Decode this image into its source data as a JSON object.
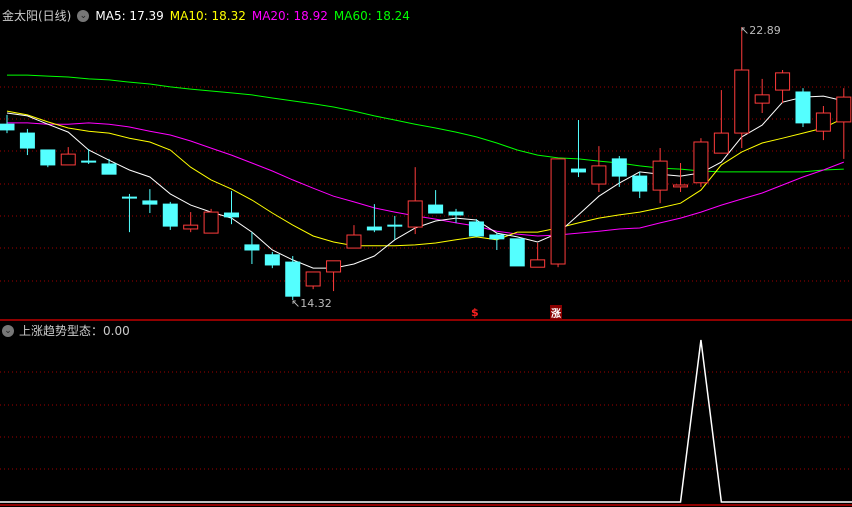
{
  "header": {
    "title": "金太阳(日线)",
    "ma5": "MA5: 17.39",
    "ma10": "MA10: 18.32",
    "ma20": "MA20: 18.92",
    "ma60": "MA60: 18.24"
  },
  "indicator": {
    "title": "上涨趋势型态",
    "value": "：0.00"
  },
  "annotations": {
    "high_label": "22.89",
    "low_label": "14.32",
    "signal_dollar": "$",
    "signal_rise": "涨"
  },
  "colors": {
    "up": "#ff3c3c",
    "down": "#54ffff",
    "ma5": "#ffffff",
    "ma10": "#ffff00",
    "ma20": "#ff00ff",
    "ma60": "#00ff00",
    "grid": "#a00000"
  },
  "chart_data": {
    "type": "candlestick",
    "price_range": [
      14.32,
      22.89
    ],
    "candles": [
      [
        19.84,
        20.13,
        19.56,
        19.66
      ],
      [
        19.56,
        19.69,
        18.87,
        19.09
      ],
      [
        19.03,
        19.03,
        18.49,
        18.56
      ],
      [
        18.56,
        19.12,
        18.56,
        18.9
      ],
      [
        18.68,
        19.06,
        18.59,
        18.66
      ],
      [
        18.59,
        18.75,
        18.27,
        18.27
      ],
      [
        17.55,
        17.65,
        16.45,
        17.53
      ],
      [
        17.43,
        17.8,
        17.05,
        17.33
      ],
      [
        17.33,
        17.4,
        16.52,
        16.64
      ],
      [
        16.55,
        17.08,
        16.45,
        16.67
      ],
      [
        16.42,
        17.18,
        16.42,
        17.08
      ],
      [
        17.05,
        17.74,
        16.7,
        16.93
      ],
      [
        16.05,
        16.45,
        15.45,
        15.89
      ],
      [
        15.74,
        15.83,
        15.32,
        15.42
      ],
      [
        15.51,
        15.7,
        14.32,
        14.44
      ],
      [
        14.76,
        15.2,
        14.66,
        15.2
      ],
      [
        15.2,
        15.55,
        14.6,
        15.55
      ],
      [
        15.95,
        16.67,
        15.95,
        16.36
      ],
      [
        16.61,
        17.33,
        16.45,
        16.52
      ],
      [
        16.67,
        16.96,
        16.21,
        16.66
      ],
      [
        16.61,
        18.49,
        16.39,
        17.43
      ],
      [
        17.3,
        17.77,
        17.05,
        17.05
      ],
      [
        17.08,
        17.18,
        16.74,
        16.99
      ],
      [
        16.77,
        16.86,
        16.3,
        16.33
      ],
      [
        16.36,
        16.42,
        15.89,
        16.24
      ],
      [
        16.24,
        16.24,
        15.39,
        15.39
      ],
      [
        15.35,
        16.11,
        15.35,
        15.58
      ],
      [
        15.45,
        18.75,
        15.35,
        18.75
      ],
      [
        18.43,
        19.97,
        18.18,
        18.34
      ],
      [
        17.96,
        19.15,
        17.71,
        18.53
      ],
      [
        18.75,
        18.84,
        17.87,
        18.21
      ],
      [
        18.21,
        18.34,
        17.52,
        17.74
      ],
      [
        17.77,
        19.09,
        17.36,
        18.68
      ],
      [
        17.87,
        18.62,
        17.71,
        17.93
      ],
      [
        18.0,
        19.4,
        17.87,
        19.28
      ],
      [
        18.93,
        20.91,
        18.93,
        19.56
      ],
      [
        19.56,
        22.89,
        19.09,
        21.54
      ],
      [
        20.5,
        21.26,
        20.19,
        20.76
      ],
      [
        20.91,
        21.54,
        20.5,
        21.45
      ],
      [
        20.85,
        20.97,
        19.75,
        19.88
      ],
      [
        19.62,
        20.41,
        19.34,
        20.19
      ],
      [
        19.91,
        20.97,
        18.75,
        20.69
      ]
    ],
    "ma5": [
      20.19,
      20.1,
      19.84,
      19.59,
      19.03,
      18.71,
      18.4,
      18.18,
      17.65,
      17.3,
      17.08,
      16.89,
      16.45,
      15.89,
      15.58,
      15.32,
      15.32,
      15.45,
      15.7,
      16.21,
      16.58,
      16.8,
      16.89,
      16.83,
      16.42,
      16.3,
      16.14,
      16.42,
      16.99,
      17.58,
      17.99,
      18.34,
      18.27,
      18.21,
      18.31,
      18.65,
      19.44,
      19.81,
      20.53,
      20.69,
      20.72,
      20.57
    ],
    "ma10": [
      20.25,
      20.13,
      19.91,
      19.72,
      19.62,
      19.56,
      19.4,
      19.28,
      19.03,
      18.49,
      18.09,
      17.8,
      17.46,
      17.05,
      16.67,
      16.33,
      16.14,
      16.02,
      16.02,
      16.02,
      16.05,
      16.11,
      16.21,
      16.3,
      16.21,
      16.45,
      16.45,
      16.58,
      16.74,
      16.89,
      16.99,
      17.08,
      17.21,
      17.36,
      17.77,
      18.56,
      18.97,
      19.25,
      19.4,
      19.56,
      19.72,
      20.03
    ],
    "ma20": [
      19.88,
      19.88,
      19.84,
      19.84,
      19.88,
      19.84,
      19.75,
      19.62,
      19.5,
      19.31,
      19.09,
      18.87,
      18.62,
      18.37,
      18.09,
      17.83,
      17.58,
      17.4,
      17.21,
      17.08,
      16.96,
      16.86,
      16.74,
      16.64,
      16.48,
      16.39,
      16.33,
      16.36,
      16.42,
      16.48,
      16.55,
      16.58,
      16.74,
      16.89,
      17.08,
      17.3,
      17.49,
      17.68,
      17.93,
      18.18,
      18.4,
      18.65
    ],
    "ma60": [
      21.38,
      21.38,
      21.35,
      21.32,
      21.26,
      21.23,
      21.16,
      21.1,
      21.01,
      20.94,
      20.88,
      20.82,
      20.76,
      20.66,
      20.57,
      20.48,
      20.38,
      20.25,
      20.1,
      19.97,
      19.84,
      19.72,
      19.59,
      19.44,
      19.25,
      19.03,
      18.87,
      18.78,
      18.75,
      18.68,
      18.62,
      18.53,
      18.46,
      18.43,
      18.37,
      18.34,
      18.34,
      18.34,
      18.34,
      18.34,
      18.4,
      18.43
    ],
    "indicator_values": [
      0,
      0,
      0,
      0,
      0,
      0,
      0,
      0,
      0,
      0,
      0,
      0,
      0,
      0,
      0,
      0,
      0,
      0,
      0,
      0,
      0,
      0,
      0,
      0,
      0,
      0,
      0,
      0,
      0,
      0,
      0,
      0,
      0,
      0,
      1,
      0,
      0,
      0,
      0,
      0,
      0,
      0
    ],
    "signals": [
      {
        "index": 23,
        "text": "$"
      },
      {
        "index": 27,
        "text": "涨"
      }
    ]
  }
}
